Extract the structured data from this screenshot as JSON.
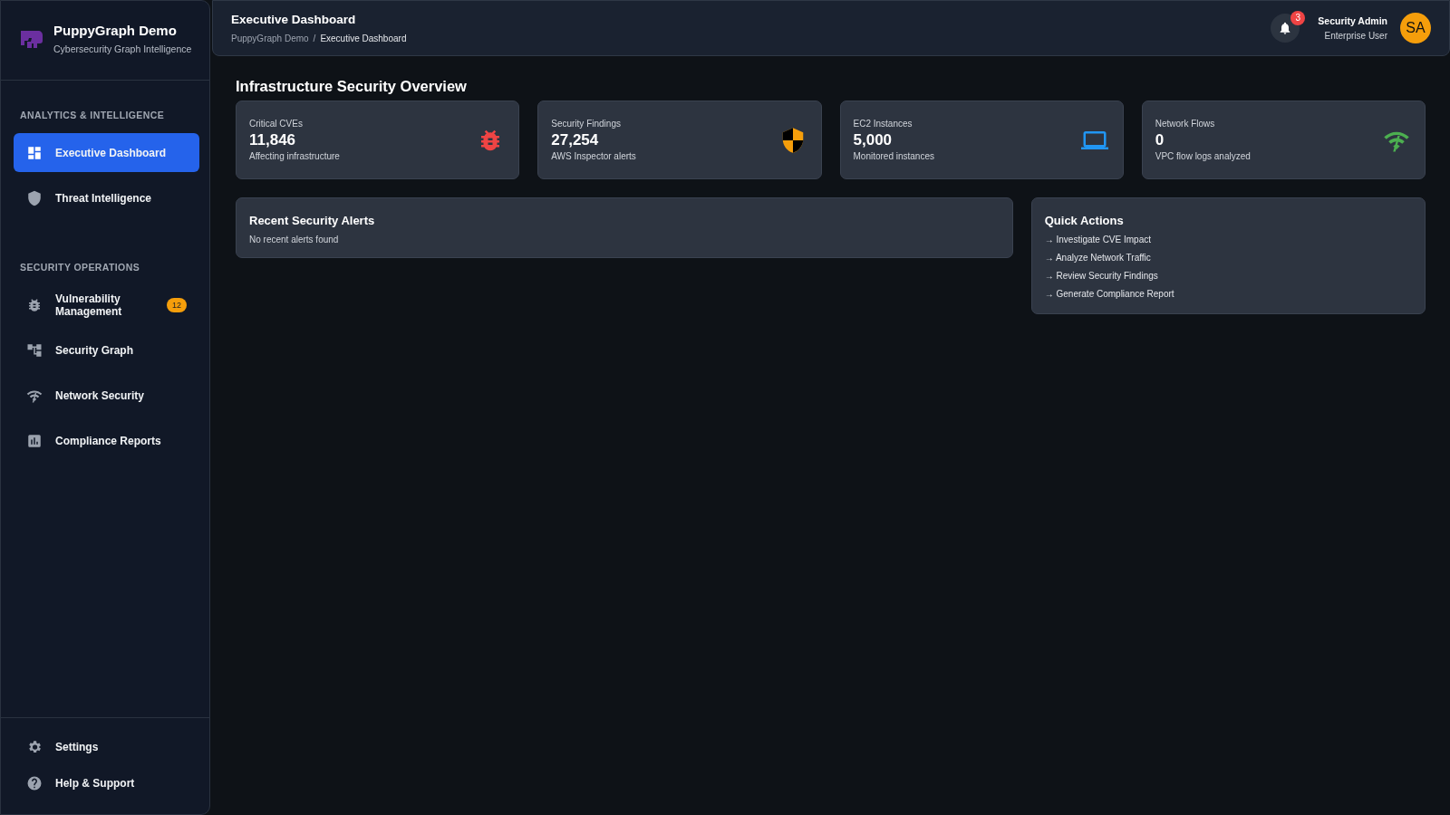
{
  "sidebar": {
    "app_name": "PuppyGraph Demo",
    "app_subtitle": "Cybersecurity Graph Intelligence",
    "sections": [
      {
        "title": "ANALYTICS & INTELLIGENCE",
        "items": [
          {
            "label": "Executive Dashboard",
            "kind": "dashboard",
            "selected": true
          },
          {
            "label": "Threat Intelligence",
            "kind": "shield",
            "selected": false
          }
        ]
      },
      {
        "title": "SECURITY OPERATIONS",
        "items": [
          {
            "label": "Vulnerability Management",
            "kind": "bug",
            "selected": false,
            "badge": "12"
          },
          {
            "label": "Security Graph",
            "kind": "graph",
            "selected": false
          },
          {
            "label": "Network Security",
            "kind": "wifi",
            "selected": false
          },
          {
            "label": "Compliance Reports",
            "kind": "chart",
            "selected": false
          }
        ]
      }
    ],
    "footer_items": [
      {
        "label": "Settings",
        "kind": "gear"
      },
      {
        "label": "Help & Support",
        "kind": "help"
      }
    ]
  },
  "header": {
    "title": "Executive Dashboard",
    "breadcrumb": [
      "PuppyGraph Demo",
      "/",
      "Executive Dashboard"
    ],
    "notification_count": "3",
    "user_name": "Security Admin",
    "user_role": "Enterprise User",
    "avatar_initials": "SA"
  },
  "main": {
    "title": "Infrastructure Security Overview",
    "stats": [
      {
        "label": "Critical CVEs",
        "value": "11,846",
        "caption": "Affecting infrastructure",
        "kind": "bug",
        "color": "#ef4444"
      },
      {
        "label": "Security Findings",
        "value": "27,254",
        "caption": "AWS Inspector alerts",
        "kind": "shield",
        "color": "#f59e0b"
      },
      {
        "label": "EC2 Instances",
        "value": "5,000",
        "caption": "Monitored instances",
        "kind": "laptop",
        "color": "#2196f3"
      },
      {
        "label": "Network Flows",
        "value": "0",
        "caption": "VPC flow logs analyzed",
        "kind": "wifi",
        "color": "#4caf50"
      }
    ],
    "alerts": {
      "title": "Recent Security Alerts",
      "empty_text": "No recent alerts found"
    },
    "quick_actions": {
      "title": "Quick Actions",
      "items": [
        "→ Investigate CVE Impact",
        "→ Analyze Network Traffic",
        "→ Review Security Findings",
        "→ Generate Compliance Report"
      ]
    }
  }
}
